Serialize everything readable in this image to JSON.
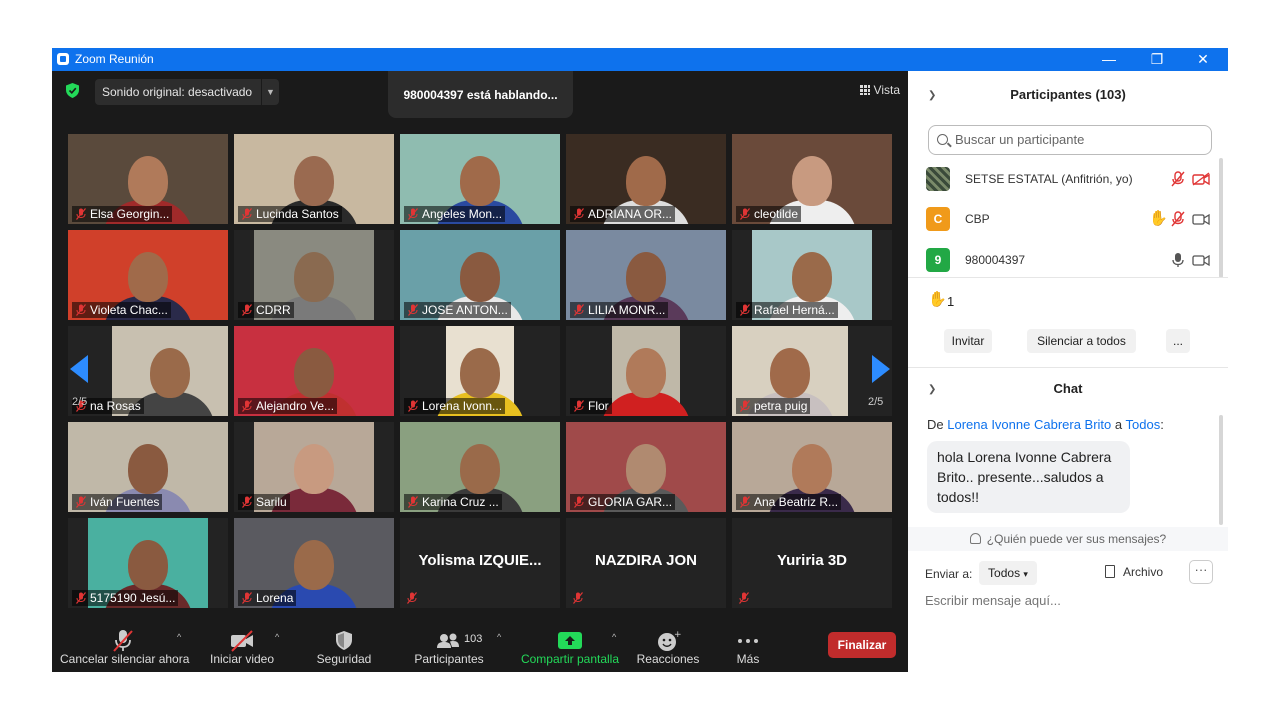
{
  "window": {
    "title": "Zoom Reunión",
    "controls": [
      "—",
      "❐",
      "✕"
    ]
  },
  "meeting": {
    "sound_label": "Sonido original: desactivado",
    "speaking_label": "980004397 está hablando...",
    "view_label": "Vista",
    "page_left": "2/5",
    "page_right": "2/5"
  },
  "tiles": [
    {
      "name": "Elsa Georgin...",
      "bg": "#5a4a3c",
      "skin": "#b07a5a",
      "shirt": "#a02a2a"
    },
    {
      "name": "Lucinda Santos",
      "bg": "#c8b8a0",
      "skin": "#9a6a50",
      "shirt": "#2a2a2a"
    },
    {
      "name": "Angeles Mon...",
      "bg": "#8fbcb0",
      "skin": "#a06a4a",
      "shirt": "#2a4aa0"
    },
    {
      "name": "ADRIANA OR...",
      "bg": "#3a2c22",
      "skin": "#a06a4a",
      "shirt": "#ddd"
    },
    {
      "name": "cleotilde",
      "bg": "#6a4a3a",
      "skin": "#c89a80",
      "shirt": "#eee"
    },
    {
      "name": "Violeta Chac...",
      "bg": "#d0402a",
      "skin": "#a06a4a",
      "shirt": "#2a2a4a"
    },
    {
      "name": "CDRR",
      "bg": "#8a8a80",
      "skin": "#8a6a50",
      "shirt": "#7a7a7a"
    },
    {
      "name": "JOSE ANTON...",
      "bg": "#6aa0a8",
      "skin": "#8a5a40",
      "shirt": "#e8e8e8"
    },
    {
      "name": "LILIA MONR...",
      "bg": "#7a8aa0",
      "skin": "#8a5a40",
      "shirt": "#5a3a5a"
    },
    {
      "name": "Rafael Herná...",
      "bg": "#a8c8c8",
      "skin": "#9a6a4a",
      "shirt": "#eeeeee"
    },
    {
      "name": "na Rosas",
      "bg": "#c8c0b0",
      "skin": "#9a6a4a",
      "shirt": "#444"
    },
    {
      "name": "Alejandro Ve...",
      "bg": "#c83040",
      "skin": "#8a5a40",
      "shirt": "#c03030"
    },
    {
      "name": "Lorena Ivonn...",
      "bg": "#e8e0d0",
      "skin": "#9a6a4a",
      "shirt": "#e8c020"
    },
    {
      "name": "Flor",
      "bg": "#bfb8a8",
      "skin": "#b07a5a",
      "shirt": "#d02020"
    },
    {
      "name": "petra puig",
      "bg": "#d8d0c0",
      "skin": "#a06a4a",
      "shirt": "#c8c0c0"
    },
    {
      "name": "Iván Fuentes",
      "bg": "#c0b8a8",
      "skin": "#8a5a40",
      "shirt": "#8a8ab0"
    },
    {
      "name": "Sarilu",
      "bg": "#b8a898",
      "skin": "#c89a80",
      "shirt": "#7a2a3a"
    },
    {
      "name": "Karina Cruz ...",
      "bg": "#8aa080",
      "skin": "#9a6a4a",
      "shirt": "#3a3a3a"
    },
    {
      "name": "GLORIA GAR...",
      "bg": "#a04a4a",
      "skin": "#b08a70",
      "shirt": "#5a5a5a"
    },
    {
      "name": "Ana Beatriz R...",
      "bg": "#b8a898",
      "skin": "#b07a5a",
      "shirt": "#3a2a4a"
    },
    {
      "name": "5175190 Jesú...",
      "bg": "#4ab0a0",
      "skin": "#8a5a40",
      "shirt": "#6a2a2a"
    },
    {
      "name": "Lorena",
      "bg": "#5a5a60",
      "skin": "#9a6a4a",
      "shirt": "#2a4ab0"
    },
    {
      "name": "Yolisma  IZQUIE...",
      "video": false
    },
    {
      "name": "NAZDIRA JON",
      "video": false
    },
    {
      "name": "Yuriria 3D",
      "video": false
    }
  ],
  "toolbar": {
    "mute_label": "Cancelar silenciar ahora",
    "video_label": "Iniciar video",
    "security_label": "Seguridad",
    "participants_label": "Participantes",
    "participants_count": "103",
    "share_label": "Compartir pantalla",
    "reactions_label": "Reacciones",
    "more_label": "Más",
    "end_label": "Finalizar",
    "share_color": "#23d959",
    "end_color": "#c12c2c"
  },
  "panel": {
    "participants_title": "Participantes (103)",
    "search_placeholder": "Buscar un participante",
    "participants": [
      {
        "name": "SETSE ESTATAL (Anfitrión, yo)",
        "avatar": "",
        "avatar_color": "#4a5a4a"
      },
      {
        "name": "CBP",
        "avatar": "C",
        "avatar_color": "#f09a1a"
      },
      {
        "name": "980004397",
        "avatar": "9",
        "avatar_color": "#22a845"
      }
    ],
    "raised_count": "1",
    "invite_label": "Invitar",
    "mute_all_label": "Silenciar a todos",
    "more_label": "...",
    "chat_title": "Chat",
    "chat_from_prefix": "De ",
    "chat_from_name": "Lorena Ivonne Cabrera Brito",
    "chat_from_mid": " a ",
    "chat_to": "Todos",
    "chat_from_suffix": ":",
    "chat_message": "hola Lorena Ivonne Cabrera Brito.. presente...saludos a todos!!",
    "who_sees": "¿Quién puede ver sus mensajes?",
    "send_to_label": "Enviar a:",
    "send_to_value": "Todos",
    "file_label": "Archivo",
    "message_placeholder": "Escribir mensaje aquí..."
  }
}
